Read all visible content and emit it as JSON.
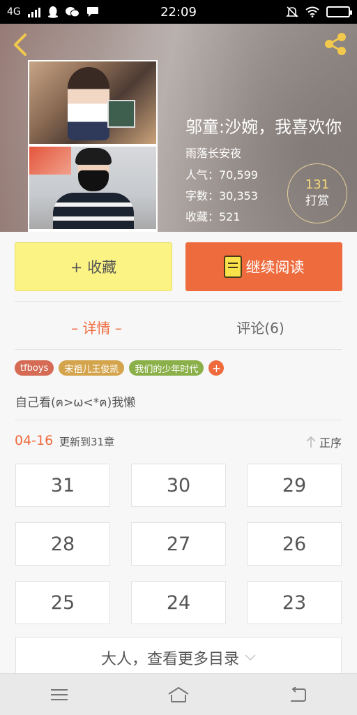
{
  "status_bar": {
    "network": "4G",
    "time": "22:09"
  },
  "book": {
    "title": "邬童:沙婉，我喜欢你",
    "author": "雨落长安夜",
    "popularity": "人气：70,599",
    "words": "字数：30,353",
    "favorites": "收藏：521",
    "reward_count": "131",
    "reward_label": "打赏"
  },
  "actions": {
    "collect": "+ 收藏",
    "read": "继续阅读"
  },
  "tabs": {
    "detail": "– 详情 –",
    "comments": "评论(6)"
  },
  "tags": [
    "tfboys",
    "宋祖儿王俊凯",
    "我们的少年时代"
  ],
  "tag_add": "+",
  "description": "自己看(ฅ>ω<*ฅ)我懒",
  "chapters": {
    "update_date": "04-16",
    "update_text": "更新到31章",
    "sort_label": "正序",
    "items": [
      "31",
      "30",
      "29",
      "28",
      "27",
      "26",
      "25",
      "24",
      "23"
    ],
    "more": "大人，查看更多目录"
  },
  "icons": {
    "back": "chevron-left-icon",
    "share": "share-icon",
    "book": "book-icon",
    "menu": "menu-icon",
    "home": "home-icon",
    "return": "return-icon"
  },
  "colors": {
    "accent": "#ee6b3d",
    "collect_button": "#fbf484",
    "reward_number": "#f6d97a"
  }
}
